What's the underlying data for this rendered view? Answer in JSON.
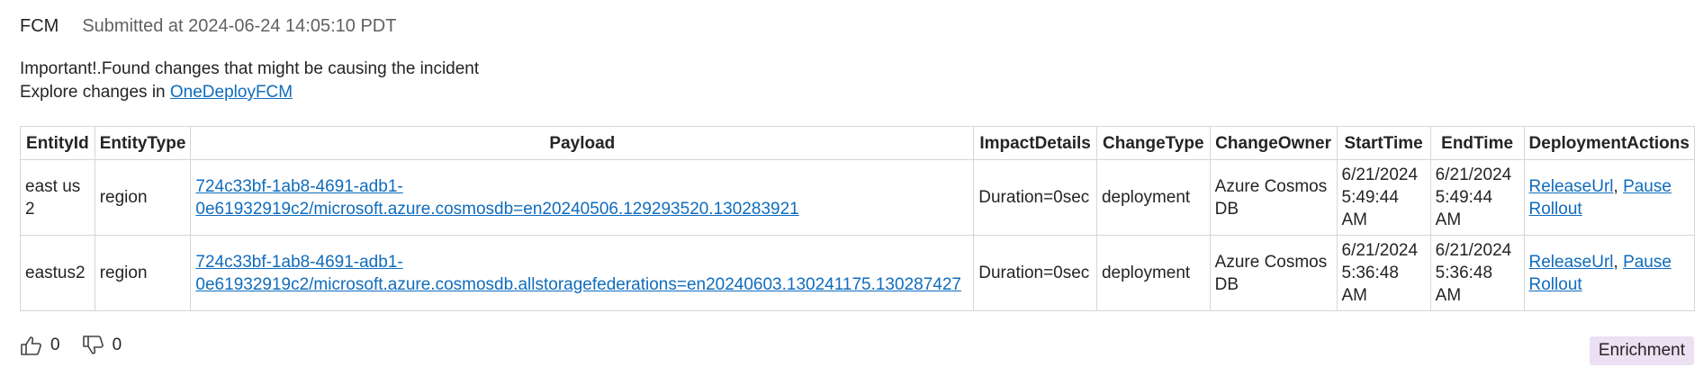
{
  "header": {
    "source": "FCM",
    "submitted": "Submitted at 2024-06-24 14:05:10 PDT"
  },
  "message": {
    "line1": "Important!.Found changes that might be causing the incident",
    "line2_prefix": "Explore changes in ",
    "link_label": "OneDeployFCM"
  },
  "table": {
    "headers": [
      "EntityId",
      "EntityType",
      "Payload",
      "ImpactDetails",
      "ChangeType",
      "ChangeOwner",
      "StartTime",
      "EndTime",
      "DeploymentActions"
    ],
    "rows": [
      {
        "entity_id": "east us 2",
        "entity_type": "region",
        "payload": "724c33bf-1ab8-4691-adb1-0e61932919c2/microsoft.azure.cosmosdb=en20240506.129293520.130283921",
        "impact": "Duration=0sec",
        "change_type": "deployment",
        "owner": "Azure Cosmos DB",
        "start": "6/21/2024 5:49:44 AM",
        "end": "6/21/2024 5:49:44 AM",
        "release_label": "ReleaseUrl",
        "separator": ", ",
        "pause_label": "Pause Rollout"
      },
      {
        "entity_id": "eastus2",
        "entity_type": "region",
        "payload": "724c33bf-1ab8-4691-adb1-0e61932919c2/microsoft.azure.cosmosdb.allstoragefederations=en20240603.130241175.130287427",
        "impact": "Duration=0sec",
        "change_type": "deployment",
        "owner": "Azure Cosmos DB",
        "start": "6/21/2024 5:36:48 AM",
        "end": "6/21/2024 5:36:48 AM",
        "release_label": "ReleaseUrl",
        "separator": ", ",
        "pause_label": "Pause Rollout"
      }
    ]
  },
  "footer": {
    "thumbs_up_icon": "thumbs-up-icon",
    "thumbs_down_icon": "thumbs-down-icon",
    "likes": "0",
    "dislikes": "0",
    "badge": "Enrichment"
  },
  "colors": {
    "link": "#0f6cbd",
    "badge_bg": "#ece0f3",
    "border": "#d6d6d6"
  }
}
